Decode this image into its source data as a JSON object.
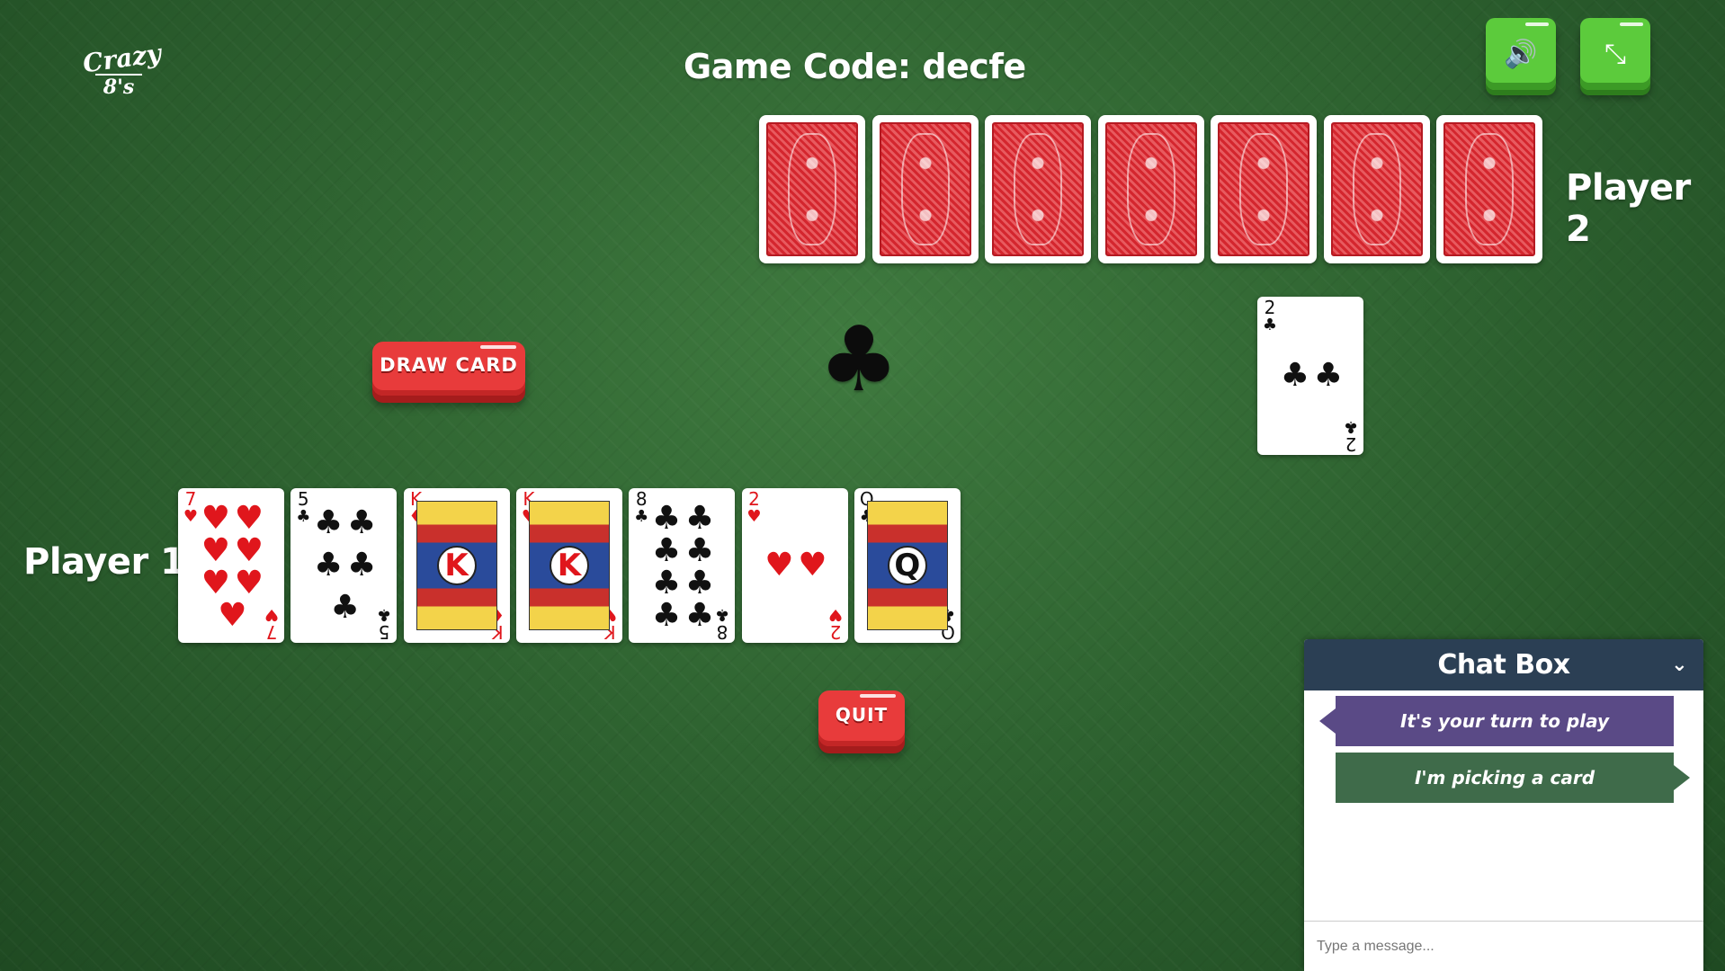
{
  "logo": {
    "line1": "Crazy",
    "line2": "8's"
  },
  "header": {
    "game_code": "Game Code: decfe"
  },
  "controls": {
    "sound_icon": "🔊",
    "fullscreen_icon": "⤡"
  },
  "players": {
    "player2": "Player 2",
    "player1": "Player 1"
  },
  "opponent_hand": {
    "count": 7
  },
  "discard_pile": {
    "rank": "2",
    "suit": "♣",
    "color": "black"
  },
  "current_suit": "♣",
  "buttons": {
    "draw": "DRAW CARD",
    "quit": "QUIT"
  },
  "player_hand": [
    {
      "rank": "7",
      "suit": "♥",
      "color": "red"
    },
    {
      "rank": "5",
      "suit": "♣",
      "color": "black"
    },
    {
      "rank": "K",
      "suit": "♦",
      "color": "red"
    },
    {
      "rank": "K",
      "suit": "♥",
      "color": "red"
    },
    {
      "rank": "8",
      "suit": "♣",
      "color": "black"
    },
    {
      "rank": "2",
      "suit": "♥",
      "color": "red"
    },
    {
      "rank": "Q",
      "suit": "♣",
      "color": "black"
    }
  ],
  "chat": {
    "title": "Chat Box",
    "toggle_icon": "⌄",
    "messages": [
      {
        "text": "It's your turn to play",
        "direction": "in"
      },
      {
        "text": "I'm picking a card",
        "direction": "out"
      }
    ],
    "input_placeholder": "Type a message..."
  }
}
